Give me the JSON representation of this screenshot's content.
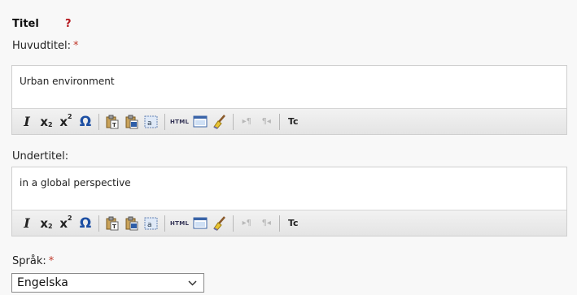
{
  "section": {
    "title": "Titel",
    "help": "?"
  },
  "main_title": {
    "label": "Huvudtitel:",
    "required": "*",
    "value": "Urban environment"
  },
  "subtitle": {
    "label": "Undertitel:",
    "value": "in a global perspective"
  },
  "toolbar": {
    "italic": "I",
    "subscript": "x",
    "subscript_mark": "2",
    "superscript": "x",
    "superscript_mark": "2",
    "special_chars": "Ω",
    "html_button": "HTML",
    "tc_button": "Tc",
    "icons": [
      "italic-icon",
      "subscript-icon",
      "superscript-icon",
      "omega-icon",
      "paste-text-icon",
      "paste-word-icon",
      "select-all-icon",
      "html-source-icon",
      "preview-icon",
      "clean-format-icon",
      "ltr-icon",
      "rtl-icon",
      "tc-icon"
    ]
  },
  "language": {
    "label": "Språk:",
    "required": "*",
    "selected": "Engelska"
  },
  "colors": {
    "required": "#c0392b",
    "help": "#b5171e",
    "omega": "#1d4fa3"
  }
}
